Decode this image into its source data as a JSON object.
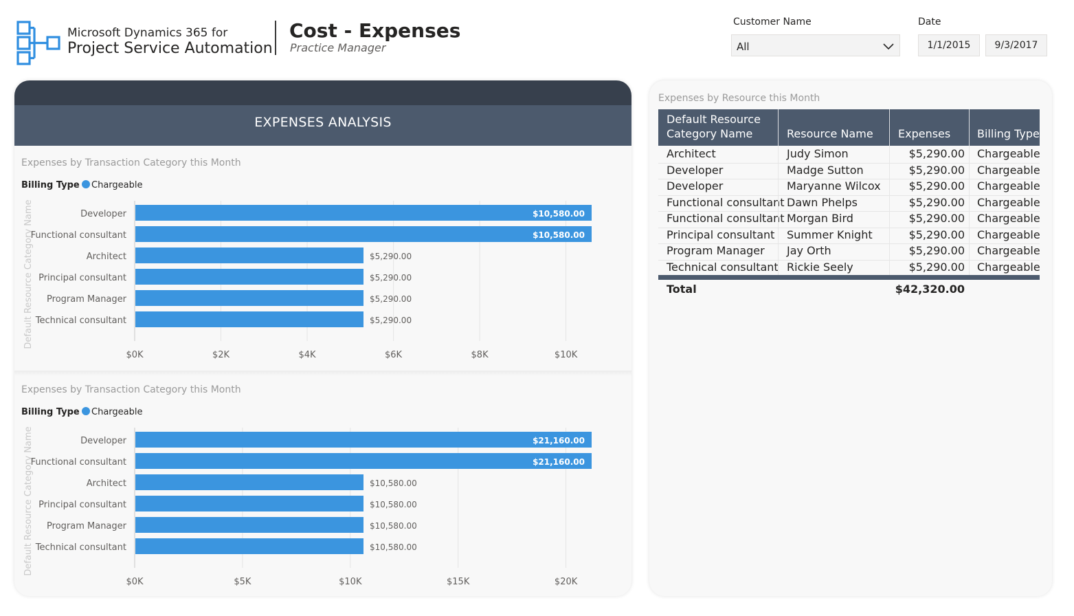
{
  "header": {
    "brand_line1": "Microsoft Dynamics 365 for",
    "brand_line2": "Project Service Automation",
    "title": "Cost - Expenses",
    "subtitle": "Practice Manager"
  },
  "filters": {
    "customer_label": "Customer Name",
    "customer_value": "All",
    "date_label": "Date",
    "date_start": "1/1/2015",
    "date_end": "9/3/2017"
  },
  "colors": {
    "bar": "#3b95df",
    "header_dark": "#37404d",
    "header": "#4c5a6d"
  },
  "left_panel": {
    "title": "EXPENSES ANALYSIS"
  },
  "chart_data": [
    {
      "type": "bar",
      "orientation": "horizontal",
      "title": "Expenses by Transaction Category this Month",
      "legend_title": "Billing Type",
      "ylabel": "Default Resource Category Name",
      "xlabel": "",
      "categories": [
        "Developer",
        "Functional consultant",
        "Architect",
        "Principal consultant",
        "Program Manager",
        "Technical consultant"
      ],
      "series": [
        {
          "name": "Chargeable",
          "values": [
            10580,
            10580,
            5290,
            5290,
            5290,
            5290
          ]
        }
      ],
      "data_labels": [
        "$10,580.00",
        "$10,580.00",
        "$5,290.00",
        "$5,290.00",
        "$5,290.00",
        "$5,290.00"
      ],
      "xlim": [
        0,
        10580
      ],
      "ticks": [
        0,
        2000,
        4000,
        6000,
        8000,
        10000
      ],
      "tick_labels": [
        "$0K",
        "$2K",
        "$4K",
        "$6K",
        "$8K",
        "$10K"
      ],
      "grid": true
    },
    {
      "type": "bar",
      "orientation": "horizontal",
      "title": "Expenses by Transaction Category this Month",
      "legend_title": "Billing Type",
      "ylabel": "Default Resource Category Name",
      "xlabel": "",
      "categories": [
        "Developer",
        "Functional consultant",
        "Architect",
        "Principal consultant",
        "Program Manager",
        "Technical consultant"
      ],
      "series": [
        {
          "name": "Chargeable",
          "values": [
            21160,
            21160,
            10580,
            10580,
            10580,
            10580
          ]
        }
      ],
      "data_labels": [
        "$21,160.00",
        "$21,160.00",
        "$10,580.00",
        "$10,580.00",
        "$10,580.00",
        "$10,580.00"
      ],
      "xlim": [
        0,
        21160
      ],
      "ticks": [
        0,
        5000,
        10000,
        15000,
        20000
      ],
      "tick_labels": [
        "$0K",
        "$5K",
        "$10K",
        "$15K",
        "$20K"
      ],
      "grid": true
    }
  ],
  "table": {
    "title": "Expenses by Resource this Month",
    "columns": [
      "Default Resource Category Name",
      "Resource Name",
      "Expenses",
      "Billing Type"
    ],
    "rows": [
      [
        "Architect",
        "Judy Simon",
        "$5,290.00",
        "Chargeable"
      ],
      [
        "Developer",
        "Madge Sutton",
        "$5,290.00",
        "Chargeable"
      ],
      [
        "Developer",
        "Maryanne Wilcox",
        "$5,290.00",
        "Chargeable"
      ],
      [
        "Functional consultant",
        "Dawn Phelps",
        "$5,290.00",
        "Chargeable"
      ],
      [
        "Functional consultant",
        "Morgan Bird",
        "$5,290.00",
        "Chargeable"
      ],
      [
        "Principal consultant",
        "Summer Knight",
        "$5,290.00",
        "Chargeable"
      ],
      [
        "Program Manager",
        "Jay Orth",
        "$5,290.00",
        "Chargeable"
      ],
      [
        "Technical consultant",
        "Rickie Seely",
        "$5,290.00",
        "Chargeable"
      ]
    ],
    "total_label": "Total",
    "total_value": "$42,320.00"
  }
}
